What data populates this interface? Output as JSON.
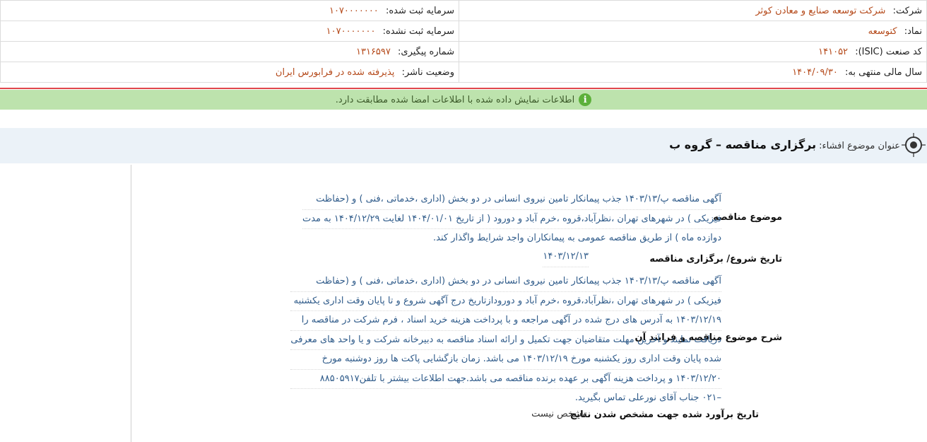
{
  "header": {
    "company_label": "شرکت:",
    "company_value": "شرکت توسعه صنایع و معادن کوثر",
    "capital_registered_label": "سرمایه ثبت شده:",
    "capital_registered_value": "۱۰۷۰۰۰۰۰۰۰",
    "symbol_label": "نماد:",
    "symbol_value": "کتوسعه",
    "capital_unregistered_label": "سرمایه ثبت نشده:",
    "capital_unregistered_value": "۱۰۷۰۰۰۰۰۰۰",
    "isic_label": "کد صنعت (ISIC):",
    "isic_value": "۱۴۱۰۵۲",
    "tracking_label": "شماره پیگیری:",
    "tracking_value": "۱۳۱۶۵۹۷",
    "fiscal_year_label": "سال مالی منتهی به:",
    "fiscal_year_value": "۱۴۰۴/۰۹/۳۰",
    "publisher_status_label": "وضعیت ناشر:",
    "publisher_status_value": "پذیرفته شده در فرابورس ایران"
  },
  "notice": {
    "icon": "info-icon",
    "text": "اطلاعات نمایش داده شده با اطلاعات امضا شده مطابقت دارد."
  },
  "subject": {
    "icon": "target-icon",
    "label": "عنوان موضوع افشاء:",
    "title": "برگزاری مناقصه – گروه ب"
  },
  "rows": {
    "tender_subject_label": "موضوع مناقصه",
    "tender_subject_lines": [
      "آگهی مناقصه پ/۱۴۰۳/۱۳ جذب پیمانکار تامین نیروی انسانی در دو بخش (اداری ،خدماتی ،فنی ) و (حفاظت",
      "فیزیکی ) در شهرهای تهران ،نظرآباد،قروه ،خرم آباد و دورود ( از تاریخ ۱۴۰۴/۰۱/۰۱ لغایت ۱۴۰۴/۱۲/۲۹ به مدت",
      "دوازده ماه ) از طریق مناقصه عمومی به پیمانکاران واجد شرایط واگذار کند."
    ],
    "start_date_label": "تاریخ شروع/ برگزاری مناقصه",
    "start_date_value": "۱۴۰۳/۱۲/۱۳",
    "description_label": "شرح موضوع مناقصه و فرایند آن",
    "description_lines": [
      "آگهی مناقصه پ/۱۴۰۳/۱۳ جذب پیمانکار تامین نیروی انسانی در دو بخش (اداری ،خدماتی ،فنی ) و (حفاظت",
      "فیزیکی ) در شهرهای تهران ،نظرآباد،قروه ،خرم آباد و دورودازتاریخ درج آگهی شروع و تا پایان وقت اداری یکشنبه",
      "۱۴۰۳/۱۲/۱۹ به آدرس های درج شده در آگهی مراجعه و با پرداخت هزینه خرید اسناد ، فرم شرکت در مناقصه را",
      "دریافت نمایند و آخرین مهلت متقاضیان جهت تکمیل و ارائه اسناد مناقصه به دبیرخانه شرکت و یا واحد های معرفی",
      "شده پایان وقت اداری روز یکشنبه مورخ ۱۴۰۳/۱۲/۱۹ می باشد. زمان بازگشایی پاکت ها روز دوشنبه مورخ",
      "۱۴۰۳/۱۲/۲۰ و پرداخت هزینه آگهی بر عهده برنده مناقصه می باشد.جهت اطلاعات بیشتر با تلفن۸۸۵۰۵۹۱۷",
      "–۰۲۱ جناب آقای نورعلی تماس بگیرید."
    ],
    "estimated_date_label": "تاریخ برآورد شده جهت مشخص شدن نتایج",
    "estimated_date_value": "مشخص نیست"
  }
}
